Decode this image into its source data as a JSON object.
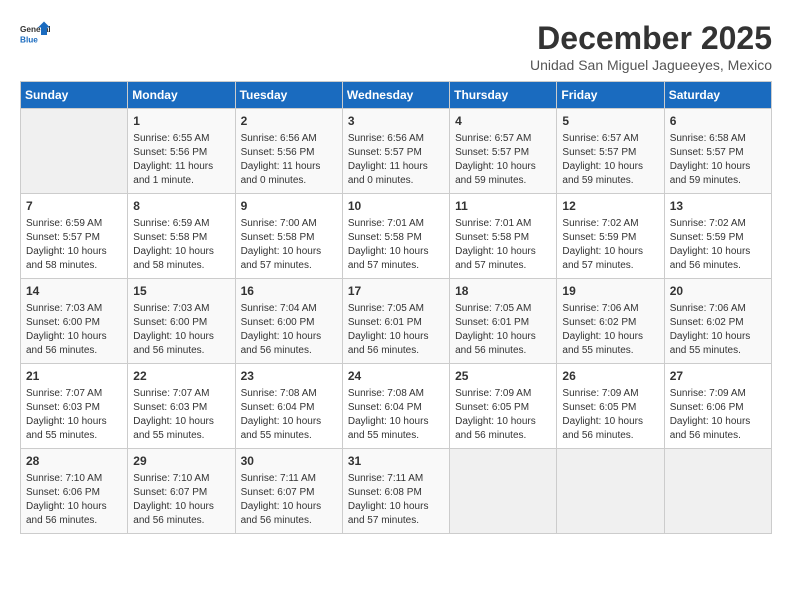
{
  "header": {
    "logo_line1": "General",
    "logo_line2": "Blue",
    "month": "December 2025",
    "location": "Unidad San Miguel Jagueeyes, Mexico"
  },
  "days_of_week": [
    "Sunday",
    "Monday",
    "Tuesday",
    "Wednesday",
    "Thursday",
    "Friday",
    "Saturday"
  ],
  "weeks": [
    [
      {
        "day": "",
        "info": ""
      },
      {
        "day": "1",
        "info": "Sunrise: 6:55 AM\nSunset: 5:56 PM\nDaylight: 11 hours\nand 1 minute."
      },
      {
        "day": "2",
        "info": "Sunrise: 6:56 AM\nSunset: 5:56 PM\nDaylight: 11 hours\nand 0 minutes."
      },
      {
        "day": "3",
        "info": "Sunrise: 6:56 AM\nSunset: 5:57 PM\nDaylight: 11 hours\nand 0 minutes."
      },
      {
        "day": "4",
        "info": "Sunrise: 6:57 AM\nSunset: 5:57 PM\nDaylight: 10 hours\nand 59 minutes."
      },
      {
        "day": "5",
        "info": "Sunrise: 6:57 AM\nSunset: 5:57 PM\nDaylight: 10 hours\nand 59 minutes."
      },
      {
        "day": "6",
        "info": "Sunrise: 6:58 AM\nSunset: 5:57 PM\nDaylight: 10 hours\nand 59 minutes."
      }
    ],
    [
      {
        "day": "7",
        "info": "Sunrise: 6:59 AM\nSunset: 5:57 PM\nDaylight: 10 hours\nand 58 minutes."
      },
      {
        "day": "8",
        "info": "Sunrise: 6:59 AM\nSunset: 5:58 PM\nDaylight: 10 hours\nand 58 minutes."
      },
      {
        "day": "9",
        "info": "Sunrise: 7:00 AM\nSunset: 5:58 PM\nDaylight: 10 hours\nand 57 minutes."
      },
      {
        "day": "10",
        "info": "Sunrise: 7:01 AM\nSunset: 5:58 PM\nDaylight: 10 hours\nand 57 minutes."
      },
      {
        "day": "11",
        "info": "Sunrise: 7:01 AM\nSunset: 5:58 PM\nDaylight: 10 hours\nand 57 minutes."
      },
      {
        "day": "12",
        "info": "Sunrise: 7:02 AM\nSunset: 5:59 PM\nDaylight: 10 hours\nand 57 minutes."
      },
      {
        "day": "13",
        "info": "Sunrise: 7:02 AM\nSunset: 5:59 PM\nDaylight: 10 hours\nand 56 minutes."
      }
    ],
    [
      {
        "day": "14",
        "info": "Sunrise: 7:03 AM\nSunset: 6:00 PM\nDaylight: 10 hours\nand 56 minutes."
      },
      {
        "day": "15",
        "info": "Sunrise: 7:03 AM\nSunset: 6:00 PM\nDaylight: 10 hours\nand 56 minutes."
      },
      {
        "day": "16",
        "info": "Sunrise: 7:04 AM\nSunset: 6:00 PM\nDaylight: 10 hours\nand 56 minutes."
      },
      {
        "day": "17",
        "info": "Sunrise: 7:05 AM\nSunset: 6:01 PM\nDaylight: 10 hours\nand 56 minutes."
      },
      {
        "day": "18",
        "info": "Sunrise: 7:05 AM\nSunset: 6:01 PM\nDaylight: 10 hours\nand 56 minutes."
      },
      {
        "day": "19",
        "info": "Sunrise: 7:06 AM\nSunset: 6:02 PM\nDaylight: 10 hours\nand 55 minutes."
      },
      {
        "day": "20",
        "info": "Sunrise: 7:06 AM\nSunset: 6:02 PM\nDaylight: 10 hours\nand 55 minutes."
      }
    ],
    [
      {
        "day": "21",
        "info": "Sunrise: 7:07 AM\nSunset: 6:03 PM\nDaylight: 10 hours\nand 55 minutes."
      },
      {
        "day": "22",
        "info": "Sunrise: 7:07 AM\nSunset: 6:03 PM\nDaylight: 10 hours\nand 55 minutes."
      },
      {
        "day": "23",
        "info": "Sunrise: 7:08 AM\nSunset: 6:04 PM\nDaylight: 10 hours\nand 55 minutes."
      },
      {
        "day": "24",
        "info": "Sunrise: 7:08 AM\nSunset: 6:04 PM\nDaylight: 10 hours\nand 55 minutes."
      },
      {
        "day": "25",
        "info": "Sunrise: 7:09 AM\nSunset: 6:05 PM\nDaylight: 10 hours\nand 56 minutes."
      },
      {
        "day": "26",
        "info": "Sunrise: 7:09 AM\nSunset: 6:05 PM\nDaylight: 10 hours\nand 56 minutes."
      },
      {
        "day": "27",
        "info": "Sunrise: 7:09 AM\nSunset: 6:06 PM\nDaylight: 10 hours\nand 56 minutes."
      }
    ],
    [
      {
        "day": "28",
        "info": "Sunrise: 7:10 AM\nSunset: 6:06 PM\nDaylight: 10 hours\nand 56 minutes."
      },
      {
        "day": "29",
        "info": "Sunrise: 7:10 AM\nSunset: 6:07 PM\nDaylight: 10 hours\nand 56 minutes."
      },
      {
        "day": "30",
        "info": "Sunrise: 7:11 AM\nSunset: 6:07 PM\nDaylight: 10 hours\nand 56 minutes."
      },
      {
        "day": "31",
        "info": "Sunrise: 7:11 AM\nSunset: 6:08 PM\nDaylight: 10 hours\nand 57 minutes."
      },
      {
        "day": "",
        "info": ""
      },
      {
        "day": "",
        "info": ""
      },
      {
        "day": "",
        "info": ""
      }
    ]
  ]
}
